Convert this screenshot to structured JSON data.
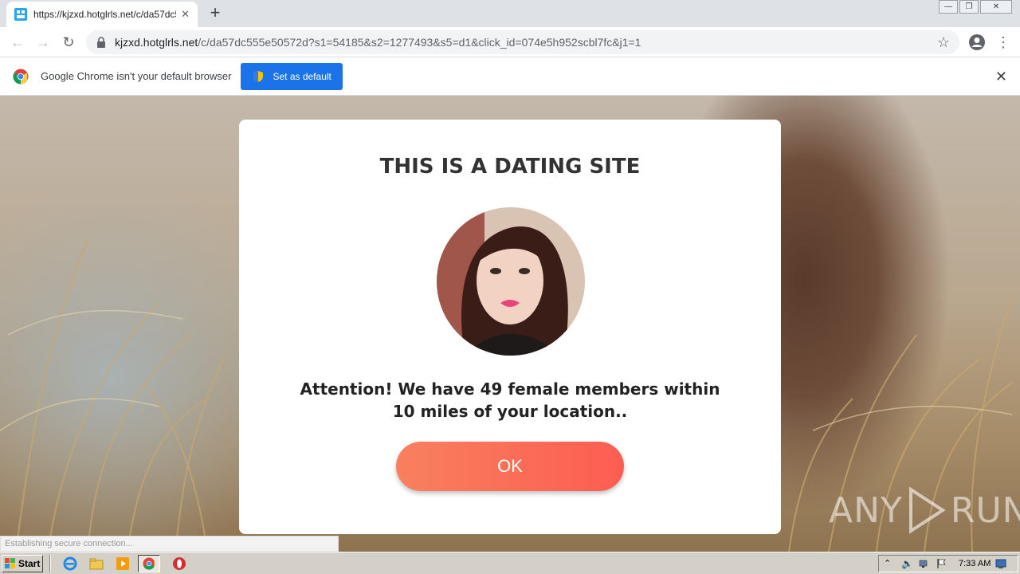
{
  "browser": {
    "tab": {
      "title": "https://kjzxd.hotglrls.net/c/da57dc5",
      "close_label": "✕"
    },
    "new_tab_label": "+",
    "url": {
      "host": "kjzxd.hotglrls.net",
      "path": "/c/da57dc555e50572d?s1=54185&s2=1277493&s5=d1&click_id=074e5h952scbl7fc&j1=1"
    },
    "infobar": {
      "message": "Google Chrome isn't your default browser",
      "button_label": "Set as default"
    }
  },
  "modal": {
    "title": "THIS IS A DATING SITE",
    "message": "Attention! We have 49 female members within 10 miles of your location..",
    "ok_label": "OK"
  },
  "watermark": {
    "left": "ANY",
    "right": "RUN"
  },
  "status_bar": {
    "text": "Establishing secure connection..."
  },
  "taskbar": {
    "start_label": "Start",
    "clock": "7:33 AM",
    "items": [
      "ie-icon",
      "explorer-icon",
      "media-player-icon",
      "chrome-icon",
      "opera-icon"
    ]
  },
  "colors": {
    "accent_blue": "#1a73e8",
    "ok_gradient_start": "#f8805f",
    "ok_gradient_end": "#fd5d51"
  }
}
